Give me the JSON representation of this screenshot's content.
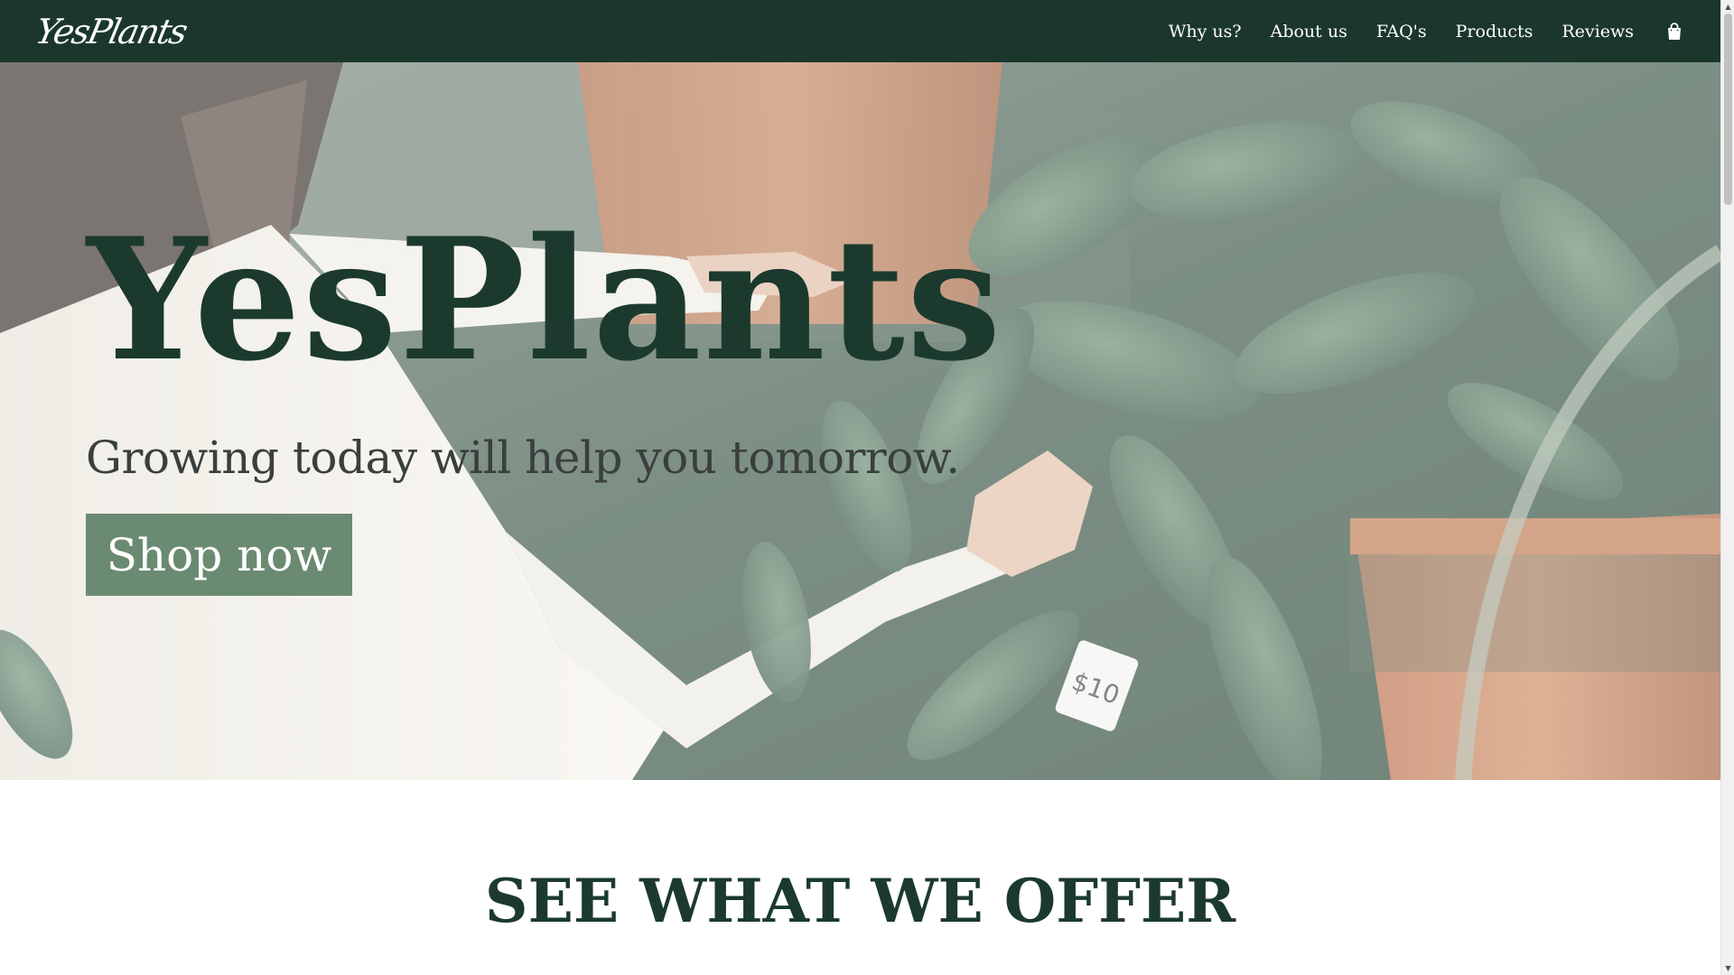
{
  "nav": {
    "logo": "YesPlants",
    "links": [
      "Why us?",
      "About us",
      "FAQ's",
      "Products",
      "Reviews"
    ],
    "cart_icon": "shopping-bag-icon"
  },
  "hero": {
    "title": "YesPlants",
    "subtitle": "Growing today will help you tomorrow.",
    "cta_label": "Shop now",
    "price_tag": "$10"
  },
  "offer": {
    "title": "SEE WHAT WE OFFER"
  },
  "colors": {
    "nav_bg": "#1b372c",
    "title_green": "#1b3a2d",
    "button_bg": "#6a8a72",
    "pot_terracotta": "#c9825b",
    "leaf_green": "#4b6b55"
  }
}
